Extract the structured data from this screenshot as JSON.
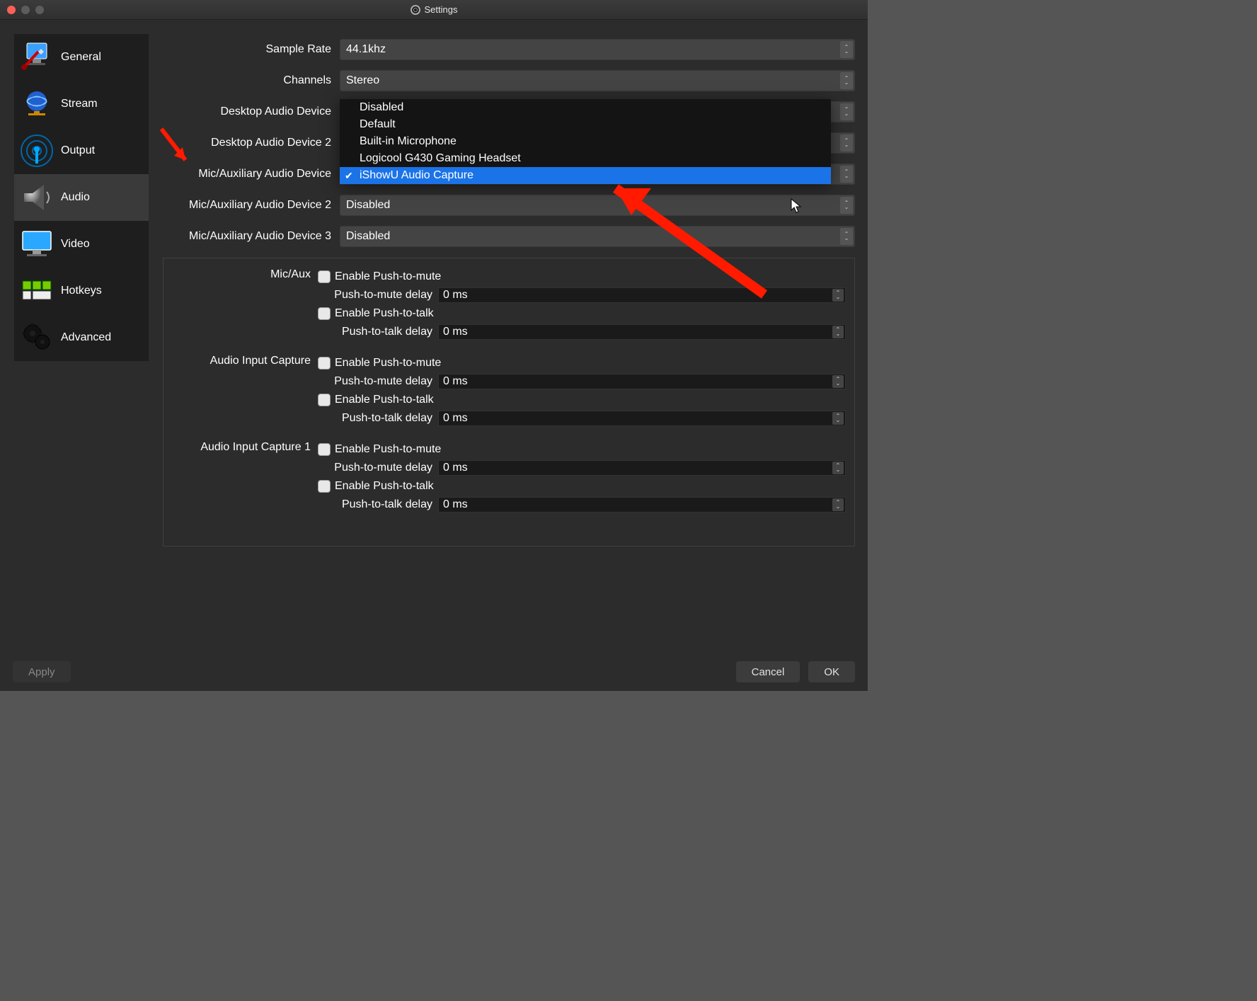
{
  "window": {
    "title": "Settings"
  },
  "sidebar": {
    "items": [
      {
        "label": "General"
      },
      {
        "label": "Stream"
      },
      {
        "label": "Output"
      },
      {
        "label": "Audio"
      },
      {
        "label": "Video"
      },
      {
        "label": "Hotkeys"
      },
      {
        "label": "Advanced"
      }
    ],
    "active_index": 3
  },
  "settings": {
    "sample_rate_label": "Sample Rate",
    "sample_rate_value": "44.1khz",
    "channels_label": "Channels",
    "channels_value": "Stereo",
    "desktop_audio_label": "Desktop Audio Device",
    "desktop_audio2_label": "Desktop Audio Device 2",
    "mic_aux_label": "Mic/Auxiliary Audio Device",
    "mic_aux2_label": "Mic/Auxiliary Audio Device 2",
    "mic_aux2_value": "Disabled",
    "mic_aux3_label": "Mic/Auxiliary Audio Device 3",
    "mic_aux3_value": "Disabled"
  },
  "dropdown": {
    "options": [
      "Disabled",
      "Default",
      "Built-in Microphone",
      "Logicool G430 Gaming Headset",
      "iShowU Audio Capture"
    ],
    "selected_index": 4
  },
  "hotkey_groups": [
    {
      "label": "Mic/Aux"
    },
    {
      "label": "Audio Input Capture"
    },
    {
      "label": "Audio Input Capture 1"
    }
  ],
  "hotkey_fields": {
    "enable_ptm": "Enable Push-to-mute",
    "ptm_delay_label": "Push-to-mute delay",
    "enable_ptt": "Enable Push-to-talk",
    "ptt_delay_label": "Push-to-talk delay",
    "delay_value": "0 ms"
  },
  "footer": {
    "apply": "Apply",
    "cancel": "Cancel",
    "ok": "OK"
  },
  "annotation": {
    "arrow_color": "#ff1a00"
  }
}
